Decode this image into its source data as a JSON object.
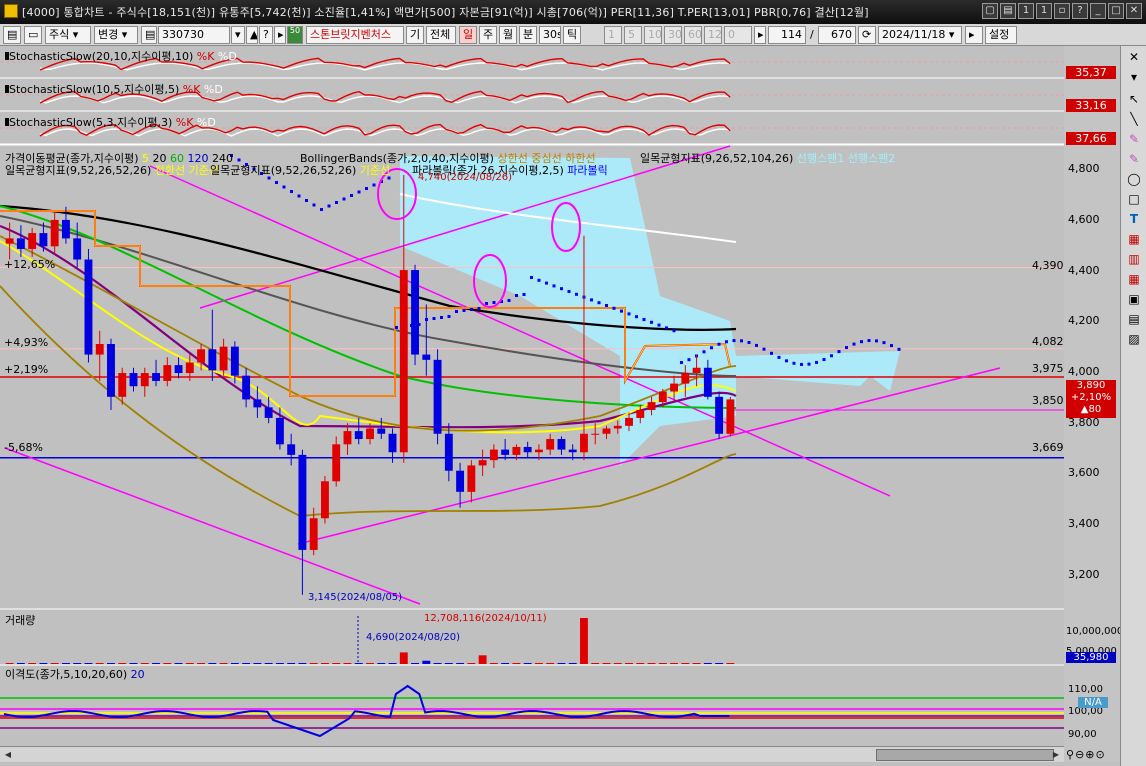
{
  "window": {
    "title": "[4000] 통합차트 - 주식수[18,151(천)] 유통주[5,742(천)] 소진율[1,41%] 액면가[500] 자본금[91(억)] 시총[706(억)] PER[11,36] T.PER[13,01] PBR[0,76] 결산[12월]"
  },
  "toolbar": {
    "market": "주식",
    "mode": "변경",
    "code": "330730",
    "stock_name": "스톤브릿지벤처스",
    "chart_type": "기",
    "range_all": "전체",
    "periods": [
      "일",
      "주",
      "월",
      "분",
      "30s",
      "틱"
    ],
    "minute_steps": [
      "1",
      "5",
      "10",
      "30",
      "60",
      "120"
    ],
    "stepper_value": "0",
    "count": "114",
    "total": "670",
    "date": "2024/11/18",
    "settings": "설정",
    "step_50": "50"
  },
  "panels": {
    "stoch1": {
      "label": "StochasticSlow(20,10,지수이평,10)",
      "k": "%K",
      "d": "%D",
      "value": "35,37"
    },
    "stoch2": {
      "label": "StochasticSlow(10,5,지수이평,5)",
      "k": "%K",
      "d": "%D",
      "value": "33,16"
    },
    "stoch3": {
      "label": "StochasticSlow(5,3,지수이평,3)",
      "k": "%K",
      "d": "%D",
      "value": "37,66"
    },
    "price": {
      "legend1": "가격이동평균(종가,지수이평)",
      "legend1_ma": [
        "5",
        "20",
        "60",
        "120",
        "240"
      ],
      "legend2": "BollingerBands(종가,2,0,40,지수이평)",
      "legend2_lines": [
        "상한선",
        "중심선",
        "하한선"
      ],
      "legend3": "일목균형지표(9,26,52,104,26)",
      "legend3_lines": [
        "선행스팬1",
        "선행스팬2"
      ],
      "legend4": "일목균형지표(9,52,26,52,26)",
      "legend4_lines": [
        "전환선",
        "기준선"
      ],
      "legend5": "일목균형지표(9,52,26,52,26)",
      "legend5_lines": [
        "기준선"
      ],
      "legend6": "파라볼릭(종가,26,지수이평,2,5)",
      "legend6_lines": [
        "파라볼릭"
      ],
      "high_note": "4,740(2024/08/26)",
      "low_note": "3,145(2024/08/05)",
      "pct_labels": [
        "+12,65%",
        "+4,93%",
        "+2,19%",
        "-5,68%"
      ],
      "level_labels": [
        "4,390",
        "4,082",
        "3,975",
        "3,850",
        "3,669"
      ],
      "axis_ticks": [
        "4,800",
        "4,600",
        "4,400",
        "4,200",
        "4,000",
        "3,800",
        "3,600",
        "3,400",
        "3,200"
      ],
      "current_price": "3,890",
      "current_change": "+2,10%",
      "current_diff": "▲80"
    },
    "volume": {
      "label": "거래량",
      "max_note": "12,708,116(2024/10/11)",
      "min_note": "4,690(2024/08/20)",
      "axis_ticks": [
        "10,000,000",
        "5,000,000"
      ],
      "current": "35,980"
    },
    "disparity": {
      "label": "이격도(종가,5,10,20,60)",
      "period_label": "20",
      "axis_ticks": [
        "110,00",
        "100,00",
        "90,00"
      ],
      "current": "N/A"
    }
  },
  "chart_data": {
    "type": "candlestick",
    "ylim": [
      3100,
      4850
    ],
    "candles": [
      [
        4480,
        4560,
        4420,
        4500
      ],
      [
        4500,
        4550,
        4430,
        4460
      ],
      [
        4460,
        4540,
        4430,
        4520
      ],
      [
        4520,
        4560,
        4450,
        4470
      ],
      [
        4470,
        4600,
        4440,
        4570
      ],
      [
        4570,
        4620,
        4480,
        4500
      ],
      [
        4500,
        4560,
        4390,
        4420
      ],
      [
        4420,
        4460,
        4030,
        4060
      ],
      [
        4060,
        4150,
        3960,
        4100
      ],
      [
        4100,
        4120,
        3850,
        3900
      ],
      [
        3900,
        4010,
        3870,
        3990
      ],
      [
        3990,
        4010,
        3920,
        3940
      ],
      [
        3940,
        4010,
        3900,
        3990
      ],
      [
        3990,
        4040,
        3940,
        3960
      ],
      [
        3960,
        4050,
        3940,
        4020
      ],
      [
        4020,
        4050,
        3970,
        3990
      ],
      [
        3990,
        4060,
        3960,
        4030
      ],
      [
        4030,
        4100,
        4000,
        4080
      ],
      [
        4080,
        4230,
        3960,
        4000
      ],
      [
        4000,
        4120,
        3980,
        4090
      ],
      [
        4090,
        4110,
        3950,
        3980
      ],
      [
        3980,
        4010,
        3860,
        3890
      ],
      [
        3890,
        3940,
        3820,
        3860
      ],
      [
        3860,
        3900,
        3800,
        3820
      ],
      [
        3820,
        3860,
        3700,
        3720
      ],
      [
        3720,
        3760,
        3640,
        3680
      ],
      [
        3680,
        3700,
        3150,
        3320
      ],
      [
        3320,
        3480,
        3300,
        3440
      ],
      [
        3440,
        3600,
        3420,
        3580
      ],
      [
        3580,
        3750,
        3560,
        3720
      ],
      [
        3720,
        3800,
        3680,
        3770
      ],
      [
        3770,
        3820,
        3720,
        3740
      ],
      [
        3740,
        3800,
        3720,
        3780
      ],
      [
        3780,
        3820,
        3740,
        3760
      ],
      [
        3760,
        3780,
        3650,
        3690
      ],
      [
        3690,
        4740,
        3650,
        4380
      ],
      [
        4380,
        4400,
        4020,
        4060
      ],
      [
        4060,
        4250,
        3980,
        4040
      ],
      [
        4040,
        4080,
        3720,
        3760
      ],
      [
        3760,
        3800,
        3580,
        3620
      ],
      [
        3620,
        3650,
        3480,
        3540
      ],
      [
        3540,
        3660,
        3500,
        3640
      ],
      [
        3640,
        3700,
        3600,
        3660
      ],
      [
        3660,
        3720,
        3630,
        3700
      ],
      [
        3700,
        3740,
        3660,
        3680
      ],
      [
        3680,
        3720,
        3660,
        3710
      ],
      [
        3710,
        3730,
        3670,
        3690
      ],
      [
        3690,
        3720,
        3660,
        3700
      ],
      [
        3700,
        3760,
        3680,
        3740
      ],
      [
        3740,
        3750,
        3680,
        3700
      ],
      [
        3700,
        3720,
        3660,
        3690
      ],
      [
        3690,
        4510,
        3660,
        3760
      ],
      [
        3760,
        3800,
        3720,
        3760
      ],
      [
        3760,
        3790,
        3740,
        3780
      ],
      [
        3780,
        3810,
        3760,
        3790
      ],
      [
        3790,
        3840,
        3770,
        3820
      ],
      [
        3820,
        3870,
        3800,
        3850
      ],
      [
        3850,
        3900,
        3830,
        3880
      ],
      [
        3880,
        3930,
        3860,
        3920
      ],
      [
        3920,
        3980,
        3880,
        3950
      ],
      [
        3950,
        4020,
        3900,
        3990
      ],
      [
        3990,
        4060,
        3940,
        4010
      ],
      [
        4010,
        4040,
        3890,
        3900
      ],
      [
        3900,
        3920,
        3740,
        3760
      ],
      [
        3760,
        3900,
        3750,
        3890
      ]
    ],
    "volume_max": 12708116,
    "disparity_range": [
      85,
      118
    ]
  }
}
